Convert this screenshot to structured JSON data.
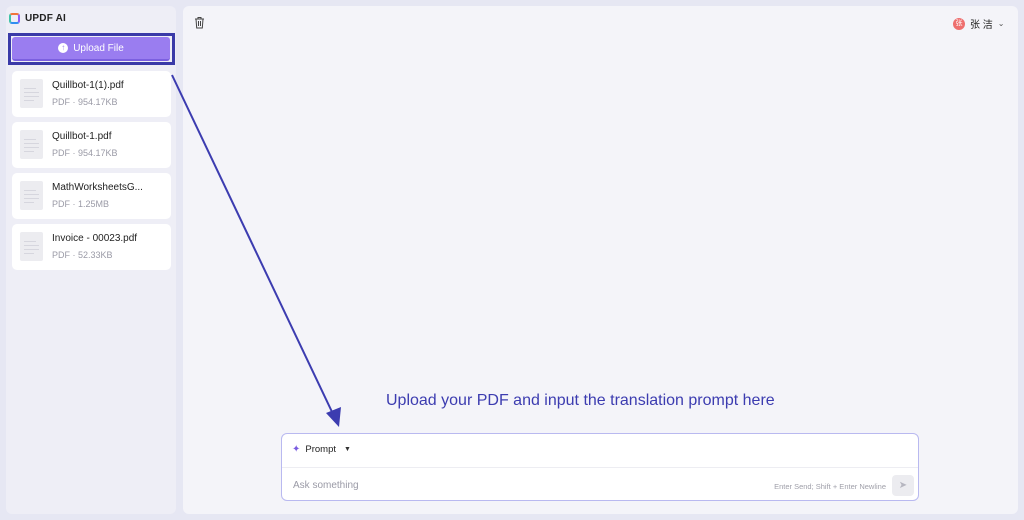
{
  "brand": {
    "name": "UPDF AI"
  },
  "sidebar": {
    "upload_label": "Upload File",
    "files": [
      {
        "name": "Quillbot-1(1).pdf",
        "meta": "PDF · 954.17KB"
      },
      {
        "name": "Quillbot-1.pdf",
        "meta": "PDF · 954.17KB"
      },
      {
        "name": "MathWorksheetsG...",
        "meta": "PDF · 1.25MB"
      },
      {
        "name": "Invoice - 00023.pdf",
        "meta": "PDF · 52.33KB"
      }
    ]
  },
  "header": {
    "user_name": "张 洁",
    "avatar_initial": "张"
  },
  "annotation": {
    "text": "Upload your PDF and input the translation prompt here"
  },
  "prompt": {
    "mode_label": "Prompt",
    "placeholder": "Ask something",
    "hint": "Enter Send; Shift + Enter Newline"
  },
  "colors": {
    "accent": "#9a7df0",
    "annotation": "#3c3cb0",
    "highlight_frame": "#3a3aa8"
  }
}
